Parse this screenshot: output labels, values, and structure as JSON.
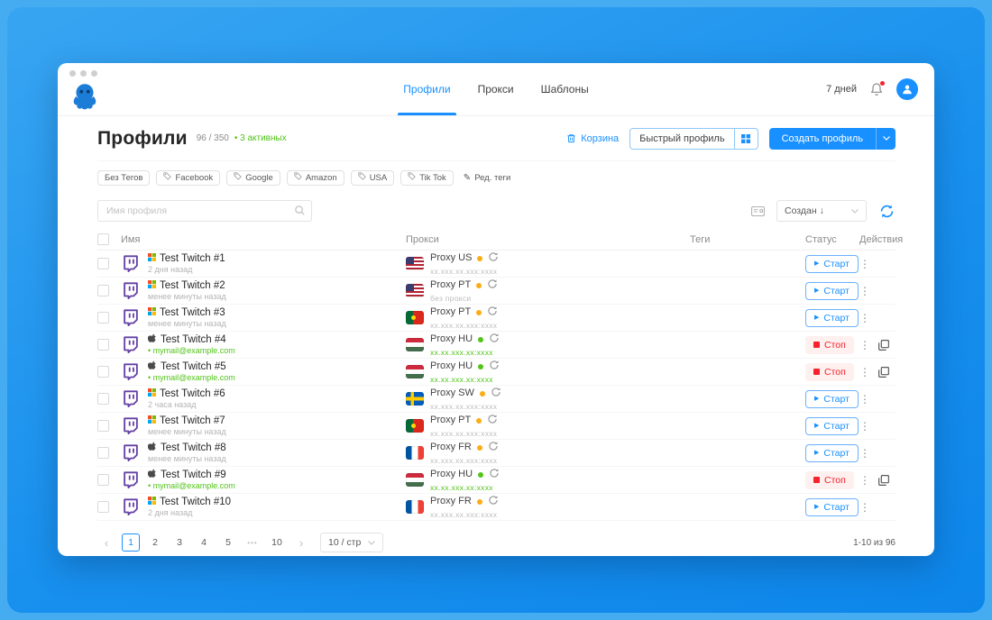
{
  "nav": {
    "tabs": [
      {
        "label": "Профили",
        "active": true
      },
      {
        "label": "Прокси",
        "active": false
      },
      {
        "label": "Шаблоны",
        "active": false
      }
    ],
    "trial": "7 дней"
  },
  "header": {
    "title": "Профили",
    "count": "96 / 350",
    "active_label": "• 3 активных",
    "trash_label": "Корзина",
    "quick_label": "Быстрый профиль",
    "create_label": "Создать профиль"
  },
  "tags": {
    "chips": [
      {
        "label": "Без Тегов",
        "icon": false
      },
      {
        "label": "Facebook",
        "icon": true
      },
      {
        "label": "Google",
        "icon": true
      },
      {
        "label": "Amazon",
        "icon": true
      },
      {
        "label": "USA",
        "icon": true
      },
      {
        "label": "Tik Tok",
        "icon": true
      }
    ],
    "edit_label": "Ред. теги",
    "edit_icon": "✎"
  },
  "toolbar": {
    "search_placeholder": "Имя профиля",
    "sort_label": "Создан ↓"
  },
  "table": {
    "columns": [
      "Имя",
      "Прокси",
      "Теги",
      "Статус",
      "Действия"
    ],
    "rows": [
      {
        "name": "Test Twitch #1",
        "os": "windows",
        "sub": "2 дня назад",
        "sub_color": "gray",
        "proxy": "Proxy US",
        "flag": "us",
        "dot": "yellow",
        "proxy_sub": "xx.xxx.xx.xxx:xxxx",
        "proxy_sub_color": "gray",
        "status": "start",
        "status_label": "Старт",
        "extra_icon": false
      },
      {
        "name": "Test Twitch #2",
        "os": "windows",
        "sub": "менее минуты назад",
        "sub_color": "gray",
        "proxy": "Proxy PT",
        "flag": "us",
        "dot": "yellow",
        "proxy_sub": "без прокси",
        "proxy_sub_color": "gray",
        "status": "start",
        "status_label": "Старт",
        "extra_icon": false
      },
      {
        "name": "Test Twitch #3",
        "os": "windows",
        "sub": "менее минуты назад",
        "sub_color": "gray",
        "proxy": "Proxy PT",
        "flag": "pt",
        "dot": "yellow",
        "proxy_sub": "xx.xxx.xx.xxx:xxxx",
        "proxy_sub_color": "gray",
        "status": "start",
        "status_label": "Старт",
        "extra_icon": false
      },
      {
        "name": "Test Twitch #4",
        "os": "apple",
        "sub": "• mymail@example.com",
        "sub_color": "green",
        "proxy": "Proxy HU",
        "flag": "hu",
        "dot": "green",
        "proxy_sub": "xx.xx.xxx.xx:xxxx",
        "proxy_sub_color": "green",
        "status": "stop",
        "status_label": "Стоп",
        "extra_icon": true
      },
      {
        "name": "Test Twitch #5",
        "os": "apple",
        "sub": "• mymail@example.com",
        "sub_color": "green",
        "proxy": "Proxy HU",
        "flag": "hu",
        "dot": "green",
        "proxy_sub": "xx.xx.xxx.xx:xxxx",
        "proxy_sub_color": "green",
        "status": "stop",
        "status_label": "Стоп",
        "extra_icon": true
      },
      {
        "name": "Test Twitch #6",
        "os": "windows",
        "sub": "2 часа назад",
        "sub_color": "gray",
        "proxy": "Proxy SW",
        "flag": "se",
        "dot": "yellow",
        "proxy_sub": "xx.xxx.xx.xxx:xxxx",
        "proxy_sub_color": "gray",
        "status": "start",
        "status_label": "Старт",
        "extra_icon": false
      },
      {
        "name": "Test Twitch #7",
        "os": "windows",
        "sub": "менее минуты назад",
        "sub_color": "gray",
        "proxy": "Proxy PT",
        "flag": "pt",
        "dot": "yellow",
        "proxy_sub": "xx.xxx.xx.xxx:xxxx",
        "proxy_sub_color": "gray",
        "status": "start",
        "status_label": "Старт",
        "extra_icon": false
      },
      {
        "name": "Test Twitch #8",
        "os": "apple",
        "sub": "менее минуты назад",
        "sub_color": "gray",
        "proxy": "Proxy FR",
        "flag": "fr",
        "dot": "yellow",
        "proxy_sub": "xx.xxx.xx.xxx:xxxx",
        "proxy_sub_color": "gray",
        "status": "start",
        "status_label": "Старт",
        "extra_icon": false
      },
      {
        "name": "Test Twitch #9",
        "os": "apple",
        "sub": "• mymail@example.com",
        "sub_color": "green",
        "proxy": "Proxy HU",
        "flag": "hu",
        "dot": "green",
        "proxy_sub": "xx.xx.xxx.xx:xxxx",
        "proxy_sub_color": "green",
        "status": "stop",
        "status_label": "Стоп",
        "extra_icon": true
      },
      {
        "name": "Test Twitch #10",
        "os": "windows",
        "sub": "2 дня назад",
        "sub_color": "gray",
        "proxy": "Proxy FR",
        "flag": "fr",
        "dot": "yellow",
        "proxy_sub": "xx.xxx.xx.xxx:xxxx",
        "proxy_sub_color": "gray",
        "status": "start",
        "status_label": "Старт",
        "extra_icon": false
      }
    ]
  },
  "pagination": {
    "prev": "‹",
    "next": "›",
    "pages": [
      "1",
      "2",
      "3",
      "4",
      "5",
      "•••",
      "10"
    ],
    "active": "1",
    "page_size": "10 / стр",
    "range": "1-10 из 96"
  }
}
